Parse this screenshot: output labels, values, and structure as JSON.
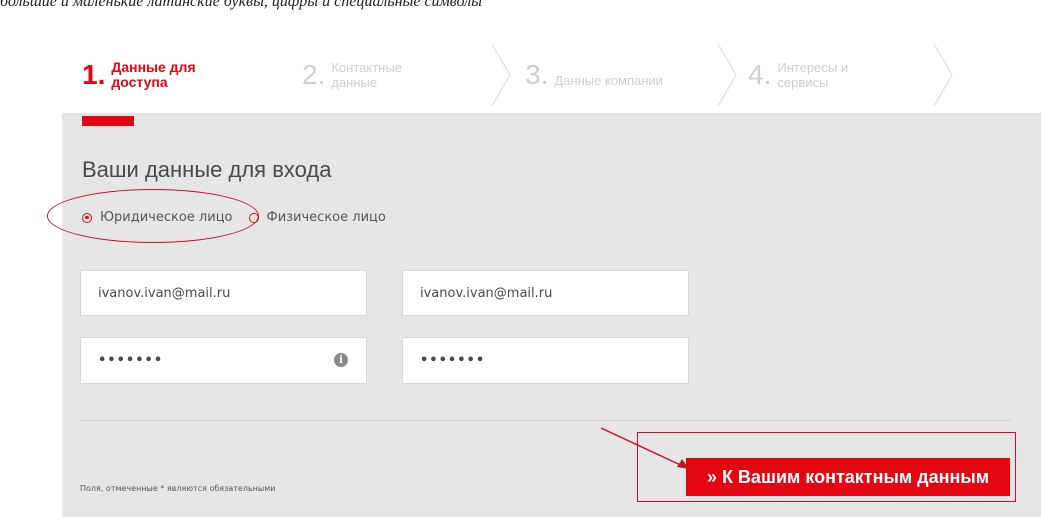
{
  "page": {
    "top_text": "большие и маленькие латинские буквы, цифры и специальные символы"
  },
  "steps": [
    {
      "num": "1.",
      "label_line1": "Данные для",
      "label_line2": "доступа"
    },
    {
      "num": "2.",
      "label_line1": "Контактные",
      "label_line2": "данные"
    },
    {
      "num": "3.",
      "label_line1": "Данные компании",
      "label_line2": ""
    },
    {
      "num": "4.",
      "label_line1": "Интересы и",
      "label_line2": "сервисы"
    }
  ],
  "form": {
    "heading": "Ваши данные для входа",
    "radio_legal": "Юридическое лицо",
    "radio_individual": "Физическое лицо",
    "email": "ivanov.ivan@mail.ru",
    "email_confirm": "ivanov.ivan@mail.ru",
    "password": "•••••••",
    "password_confirm": "•••••••",
    "required_note": "Поля, отмеченные * являются обязательными",
    "submit_label": "» К Вашим контактным данным"
  },
  "colors": {
    "accent": "#e30613",
    "panel": "#e6e6e6",
    "annotation": "#c8102e"
  },
  "icons": {
    "info": "info-icon"
  }
}
